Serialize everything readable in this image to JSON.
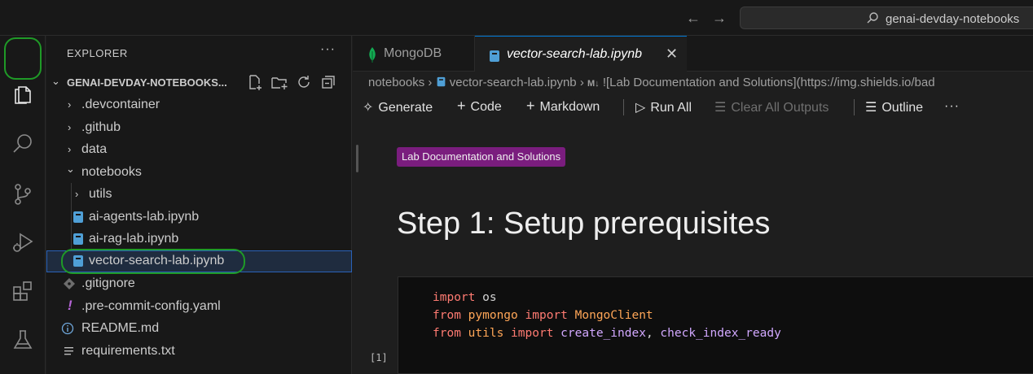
{
  "titlebar": {
    "search_text": "genai-devday-notebooks"
  },
  "activity_bar": {
    "items": [
      {
        "icon": "files-icon",
        "active": true
      },
      {
        "icon": "search-icon",
        "active": false
      },
      {
        "icon": "source-control-icon",
        "active": false
      },
      {
        "icon": "run-debug-icon",
        "active": false
      },
      {
        "icon": "extensions-icon",
        "active": false
      },
      {
        "icon": "testing-flask-icon",
        "active": false
      }
    ]
  },
  "sidebar": {
    "title": "EXPLORER",
    "more": "···",
    "root_label": "GENAI-DEVDAY-NOTEBOOKS...",
    "tree": [
      {
        "label": ".devcontainer",
        "type": "folder",
        "expanded": false,
        "depth": 1
      },
      {
        "label": ".github",
        "type": "folder",
        "expanded": false,
        "depth": 1
      },
      {
        "label": "data",
        "type": "folder",
        "expanded": false,
        "depth": 1
      },
      {
        "label": "notebooks",
        "type": "folder",
        "expanded": true,
        "depth": 1
      },
      {
        "label": "utils",
        "type": "folder",
        "expanded": false,
        "depth": 2
      },
      {
        "label": "ai-agents-lab.ipynb",
        "type": "notebook",
        "depth": 2
      },
      {
        "label": "ai-rag-lab.ipynb",
        "type": "notebook",
        "depth": 2
      },
      {
        "label": "vector-search-lab.ipynb",
        "type": "notebook",
        "depth": 2,
        "selected": true
      },
      {
        "label": ".gitignore",
        "type": "git",
        "depth": 1
      },
      {
        "label": ".pre-commit-config.yaml",
        "type": "yaml",
        "depth": 1
      },
      {
        "label": "README.md",
        "type": "info",
        "depth": 1
      },
      {
        "label": "requirements.txt",
        "type": "text",
        "depth": 1
      }
    ]
  },
  "tabs": [
    {
      "label": "MongoDB",
      "icon": "mongodb-leaf-icon"
    },
    {
      "label": "vector-search-lab.ipynb",
      "icon": "notebook-icon",
      "active": true
    }
  ],
  "breadcrumb": {
    "folder": "notebooks",
    "file": "vector-search-lab.ipynb",
    "md_marker": "M↓",
    "symbol": "![Lab Documentation and Solutions](https://img.shields.io/bad"
  },
  "toolbar": {
    "generate": "Generate",
    "code": "Code",
    "markdown": "Markdown",
    "run_all": "Run All",
    "clear_outputs": "Clear All Outputs",
    "outline": "Outline",
    "more": "···"
  },
  "notebook": {
    "badge": "Lab Documentation and Solutions",
    "heading": "Step 1: Setup prerequisites",
    "code": {
      "line1": {
        "kw1": "import",
        "rest": " os"
      },
      "line2": {
        "kw1": "from",
        "mod": "pymongo",
        "kw2": "import",
        "name": "MongoClient"
      },
      "line3": {
        "kw1": "from",
        "mod": "utils",
        "kw2": "import",
        "fn1": "create_index",
        "sep": ", ",
        "fn2": "check_index_ready"
      }
    },
    "exec_count": "[1]"
  },
  "colors": {
    "accent": "#0078d4",
    "highlight_ring": "#1f9a27",
    "badge_bg": "#7a1d7e"
  }
}
